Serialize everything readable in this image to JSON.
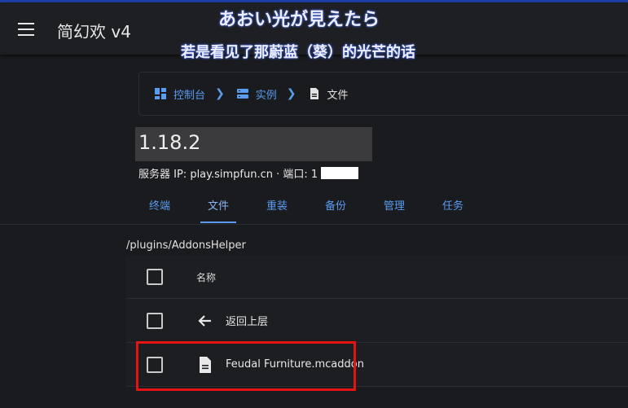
{
  "app": {
    "title": "简幻欢 v4"
  },
  "overlay": {
    "line1": "あおい光が見えたら",
    "line2": "若是看见了那蔚蓝（葵）的光芒的话"
  },
  "breadcrumb": {
    "items": [
      {
        "label": "控制台",
        "icon": "dashboard-icon"
      },
      {
        "label": "实例",
        "icon": "server-icon"
      },
      {
        "label": "文件",
        "icon": "file-icon"
      }
    ]
  },
  "instance": {
    "name": "1.18.2",
    "server_info": "服务器 IP: play.simpfun.cn · 端口: 1"
  },
  "tabs": [
    "终端",
    "文件",
    "重装",
    "备份",
    "管理",
    "任务"
  ],
  "active_tab": "文件",
  "files": {
    "path": "/plugins/AddonsHelper",
    "header_name": "名称",
    "back_label": "返回上层",
    "items": [
      {
        "name": "Feudal Furniture.mcaddon",
        "icon": "file-icon"
      }
    ]
  },
  "colors": {
    "accent": "#5b9bf0",
    "highlight": "#e51414",
    "background": "#1a1b1e"
  }
}
